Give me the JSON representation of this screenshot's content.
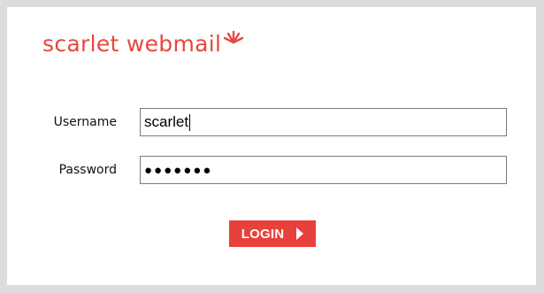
{
  "brand": {
    "logo_text": "scarlet webmail",
    "logo_icon": "flame-burst-icon",
    "color": "#e5483f"
  },
  "form": {
    "username_label": "Username",
    "username_value": "scarlet",
    "password_label": "Password",
    "password_value": "●●●●●●●",
    "login_label": "LOGIN",
    "login_icon": "chevron-right-icon",
    "button_color": "#e8403a"
  },
  "page": {
    "background": "#dcdcdc",
    "panel_background": "#ffffff"
  }
}
